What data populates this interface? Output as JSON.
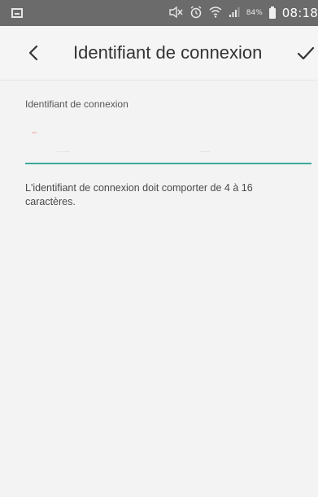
{
  "status_bar": {
    "battery_percent": "84%",
    "time": "08:18",
    "icons": [
      "notification-icon",
      "mute-icon",
      "alarm-icon",
      "wifi-icon",
      "signal-icon",
      "battery-icon"
    ]
  },
  "app_bar": {
    "title": "Identifiant de connexion",
    "back_icon": "chevron-left-icon",
    "confirm_icon": "check-icon"
  },
  "form": {
    "field_label": "Identifiant de connexion",
    "login_value": "",
    "login_placeholder": "",
    "helper_text": "L'identifiant de connexion doit comporter de 4 à 16 caractères."
  },
  "colors": {
    "status_bar": "#6b6b6b",
    "background": "#f3f3f3",
    "accent": "#3aa99a",
    "title_text": "#333333"
  }
}
